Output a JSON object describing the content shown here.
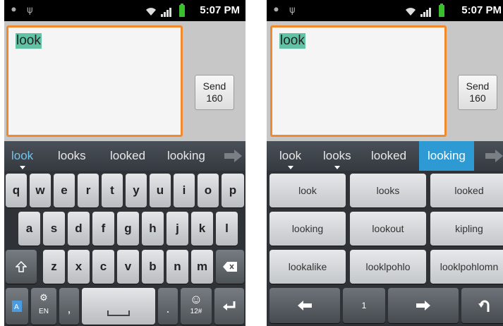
{
  "status": {
    "time": "5:07 PM"
  },
  "compose": {
    "text": "look",
    "send_label": "Send",
    "char_count": "160"
  },
  "left_suggestions": [
    "look",
    "looks",
    "looked",
    "looking"
  ],
  "right_suggestions": [
    "look",
    "looks",
    "looked",
    "looking"
  ],
  "left_keyboard": {
    "row1": [
      "q",
      "w",
      "e",
      "r",
      "t",
      "y",
      "u",
      "i",
      "o",
      "p"
    ],
    "row2": [
      "a",
      "s",
      "d",
      "f",
      "g",
      "h",
      "j",
      "k",
      "l"
    ],
    "row3": [
      "z",
      "x",
      "c",
      "v",
      "b",
      "n",
      "m"
    ],
    "shift_icon": "shift-icon",
    "backspace_icon": "backspace-icon",
    "lang_label": "EN",
    "comma": ",",
    "period": ".",
    "sym_label": "12#",
    "enter_icon": "enter-icon"
  },
  "right_keyboard": {
    "predictions": [
      "look",
      "looks",
      "looked",
      "looking",
      "lookout",
      "kipling",
      "lookalike",
      "looklpohlo",
      "looklpohlomn"
    ],
    "page_number": "1"
  },
  "colors": {
    "accent": "#2d9ad4",
    "highlight": "#62c3a4",
    "focus_border": "#f08a2d"
  }
}
